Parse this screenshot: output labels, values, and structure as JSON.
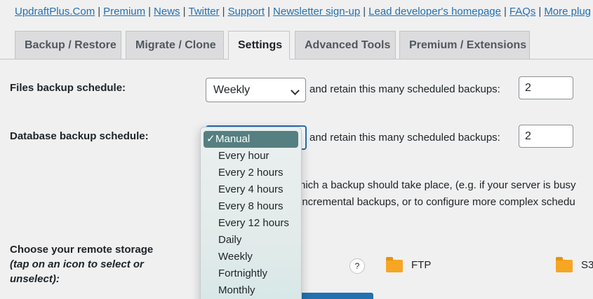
{
  "top_links": [
    "UpdraftPlus.Com",
    "Premium",
    "News",
    "Twitter",
    "Support",
    "Newsletter sign-up",
    "Lead developer's homepage",
    "FAQs",
    "More plug"
  ],
  "tabs": [
    {
      "label": "Backup / Restore"
    },
    {
      "label": "Migrate / Clone"
    },
    {
      "label": "Settings"
    },
    {
      "label": "Advanced Tools"
    },
    {
      "label": "Premium / Extensions"
    }
  ],
  "files_schedule": {
    "label": "Files backup schedule:",
    "value": "Weekly",
    "retain_text": "and retain this many scheduled backups:",
    "retain_value": "2"
  },
  "db_schedule": {
    "label": "Database backup schedule:",
    "retain_text": "and retain this many scheduled backups:",
    "retain_value": "2"
  },
  "description": {
    "line1": "hich a backup should take place, (e.g. if your server is busy",
    "line2": "incremental backups, or to configure more complex schedu"
  },
  "storage": {
    "label_line1": "Choose your remote storage",
    "label_line2": "(tap on an icon to select or",
    "label_line3": "unselect):",
    "help": "?",
    "options": [
      "FTP",
      "S3"
    ]
  },
  "dropdown": {
    "check": "✓",
    "selected_index": 0,
    "options": [
      "Manual",
      "Every hour",
      "Every 2 hours",
      "Every 4 hours",
      "Every 8 hours",
      "Every 12 hours",
      "Daily",
      "Weekly",
      "Fortnightly",
      "Monthly"
    ]
  },
  "colors": {
    "link": "#2271b1",
    "selected_option_bg": "#557f80",
    "folder": "#f6a623"
  }
}
